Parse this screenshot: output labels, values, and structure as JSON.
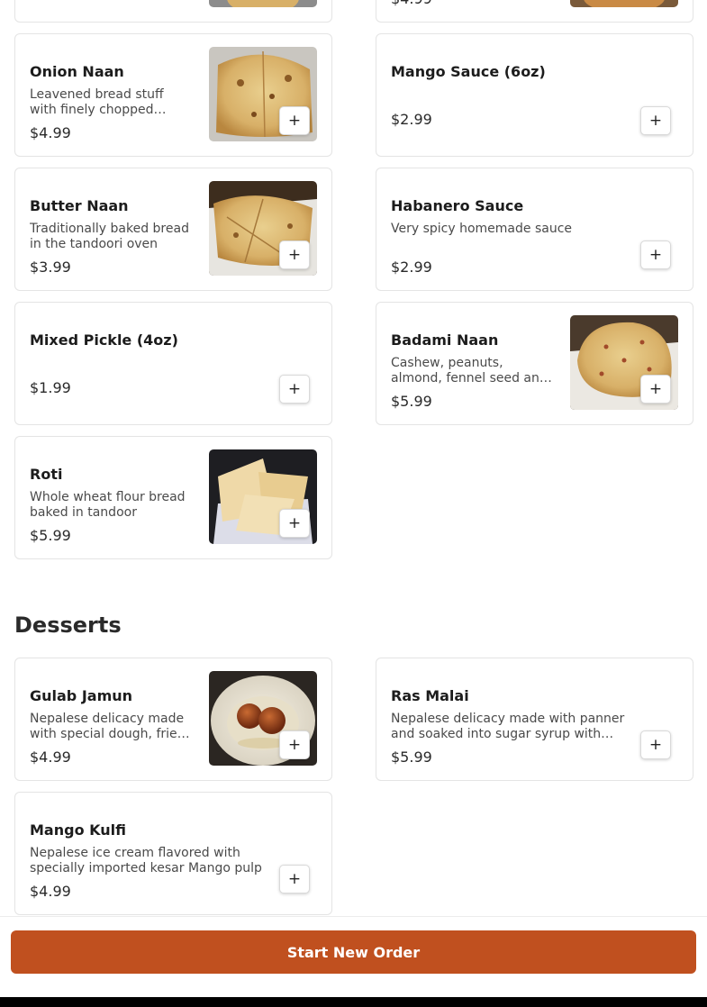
{
  "menu": {
    "items": [
      {
        "name": "Onion Naan",
        "description": "Leavened bread stuff with finely chopped onions",
        "price": "$4.99"
      },
      {
        "name": "Mango Sauce (6oz)",
        "description": "",
        "price": "$2.99"
      },
      {
        "name": "Butter Naan",
        "description": "Traditionally baked bread in the tandoori oven",
        "price": "$3.99"
      },
      {
        "name": "Habanero Sauce",
        "description": "Very spicy homemade sauce",
        "price": "$2.99"
      },
      {
        "name": "Mixed Pickle (4oz)",
        "description": "",
        "price": "$1.99"
      },
      {
        "name": "Badami Naan",
        "description": "Cashew, peanuts, almond, fennel seed and raisins",
        "price": "$5.99"
      },
      {
        "name": "Roti",
        "description": "Whole wheat flour bread baked in tandoor",
        "price": "$5.99"
      }
    ],
    "add_label": "+",
    "partial_top_price": "$4.99"
  },
  "desserts": {
    "title": "Desserts",
    "items": [
      {
        "name": "Gulab Jamun",
        "description": "Nepalese delicacy made with special dough, fried and soaked in syrup",
        "price": "$4.99"
      },
      {
        "name": "Ras Malai",
        "description": "Nepalese delicacy made with panner and soaked into sugar syrup with milk",
        "price": "$5.99"
      },
      {
        "name": "Mango Kulfi",
        "description": "Nepalese ice cream flavored with specially imported kesar Mango pulp",
        "price": "$4.99"
      }
    ]
  },
  "footer": {
    "start_order_label": "Start New Order"
  },
  "colors": {
    "accent": "#c0501f"
  }
}
